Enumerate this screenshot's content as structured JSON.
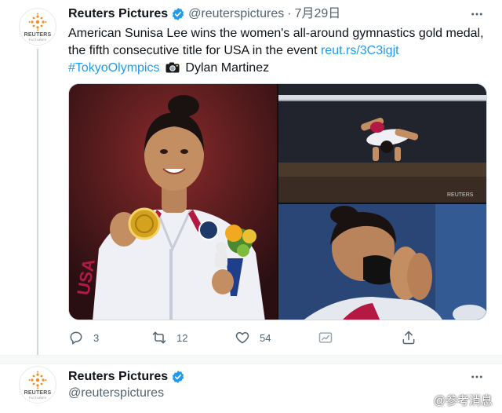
{
  "tweet": {
    "author_name": "Reuters Pictures",
    "handle": "@reuterspictures",
    "separator": "·",
    "date": "7月29日",
    "text_line1": "American Sunisa Lee wins the women's all-around gymnastics gold medal,",
    "text_line2_prefix": "the fifth consecutive title for USA in the event",
    "link": "reut.rs/3C3igjt",
    "hashtag": "#TokyoOlympics",
    "photographer": "Dylan Martinez",
    "replies": "3",
    "retweets": "12",
    "likes": "54"
  },
  "avatar": {
    "brand": "REUTERS",
    "sub": "PICTURES"
  },
  "media": {
    "watermark": "REUTERS"
  },
  "next_tweet": {
    "author_name": "Reuters Pictures",
    "handle": "@reuterspictures"
  },
  "watermark": {
    "text": "@参考消息"
  },
  "colors": {
    "link": "#1d9bf0",
    "verified": "#1d9bf0",
    "muted": "#536471",
    "brand_orange": "#f08a24"
  },
  "icons": [
    "reuters-logo-icon",
    "verified-badge-icon",
    "more-icon",
    "camera-icon",
    "reply-icon",
    "retweet-icon",
    "like-icon",
    "analytics-icon",
    "share-icon",
    "weibo-icon"
  ]
}
